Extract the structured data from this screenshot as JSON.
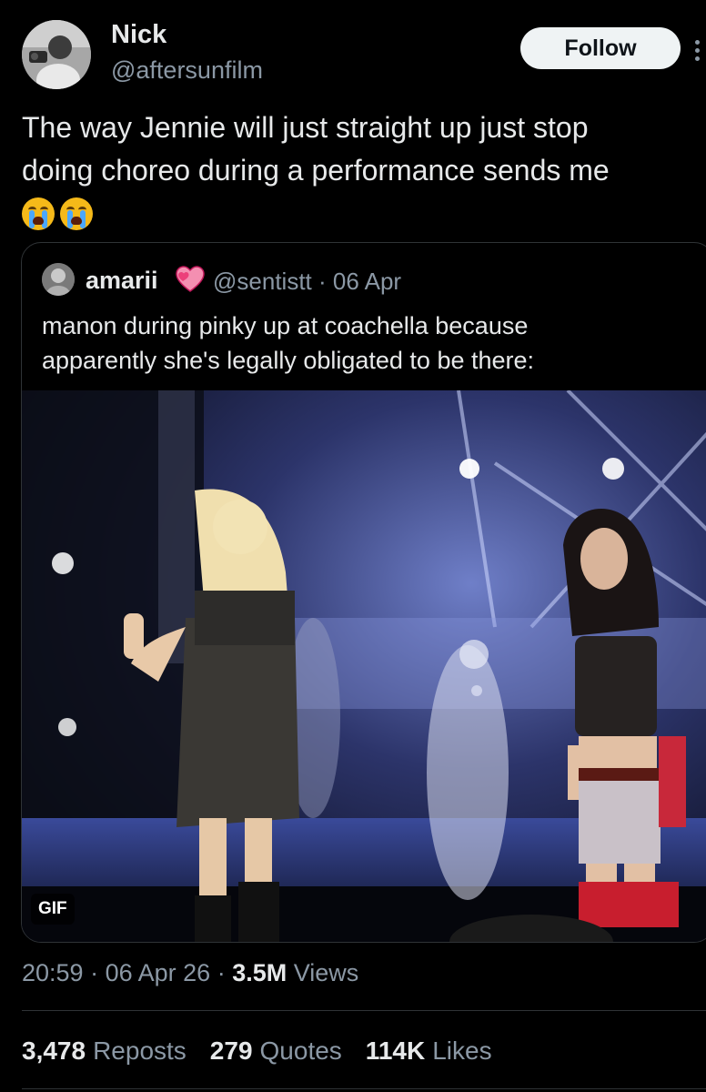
{
  "author": {
    "name": "Nick",
    "handle": "@aftersunfilm",
    "follow_label": "Follow"
  },
  "tweet": {
    "lines": [
      "The way Jennie will just straight up just stop",
      "doing choreo during a performance sends me"
    ],
    "emojis": [
      "loudly-crying-face-icon",
      "loudly-crying-face-icon"
    ]
  },
  "quote": {
    "name": "amarii",
    "badge_icon": "revolving-hearts-icon",
    "handle": "@sentistt",
    "date": "06 Apr",
    "lines": [
      "manon during pinky up at coachella because",
      "apparently she's legally obligated to be there:"
    ],
    "media_badge": "GIF"
  },
  "meta": {
    "time": "20:59",
    "date": "06 Apr 26",
    "views_count": "3.5M",
    "views_label": "Views"
  },
  "stats": {
    "reposts": {
      "count": "3,478",
      "label": "Reposts"
    },
    "quotes": {
      "count": "279",
      "label": "Quotes"
    },
    "likes": {
      "count": "114K",
      "label": "Likes"
    }
  },
  "colors": {
    "background": "#000000",
    "text": "#e7e9ea",
    "muted": "#8b98a5",
    "border": "#2f3336",
    "follow_button": "#eff3f4"
  }
}
